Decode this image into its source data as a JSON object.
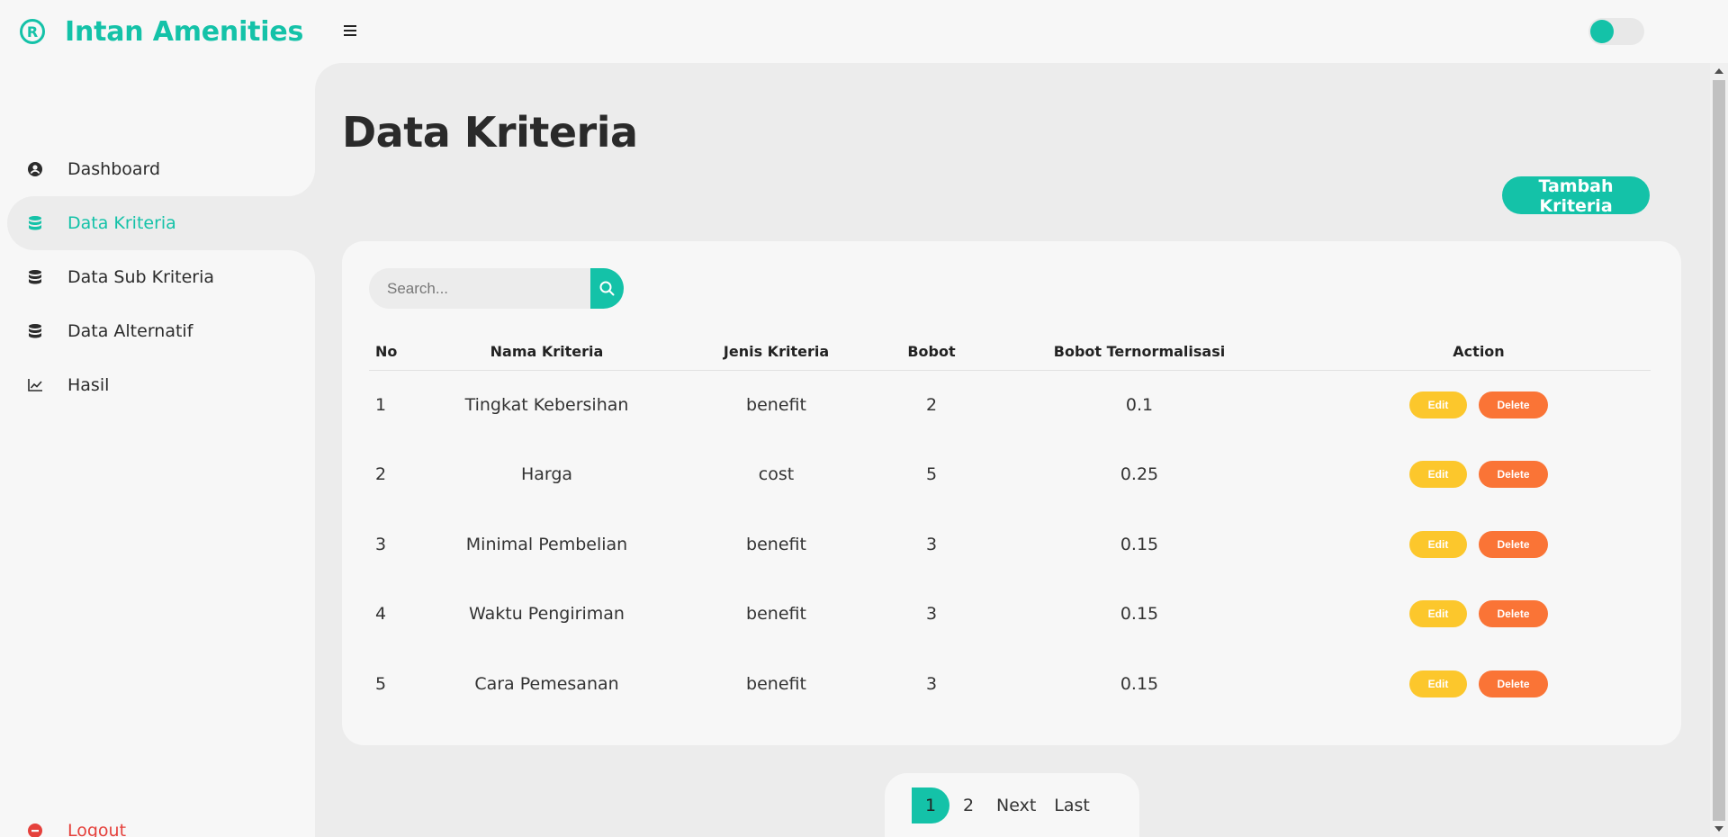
{
  "app": {
    "brand_name": "Intan Amenities",
    "brand_icon": "registered-icon",
    "accent_color": "#14c2a8"
  },
  "sidebar": {
    "items": [
      {
        "label": "Dashboard",
        "icon": "user-circle-icon",
        "active": false
      },
      {
        "label": "Data Kriteria",
        "icon": "database-icon",
        "active": true
      },
      {
        "label": "Data Sub Kriteria",
        "icon": "database-icon",
        "active": false
      },
      {
        "label": "Data Alternatif",
        "icon": "database-icon",
        "active": false
      },
      {
        "label": "Hasil",
        "icon": "line-chart-icon",
        "active": false
      }
    ],
    "logout_label": "Logout"
  },
  "main": {
    "title": "Data Kriteria",
    "add_button_label": "Tambah Kriteria",
    "search": {
      "placeholder": "Search..."
    }
  },
  "table": {
    "headers": [
      "No",
      "Nama Kriteria",
      "Jenis Kriteria",
      "Bobot",
      "Bobot Ternormalisasi",
      "Action"
    ],
    "edit_label": "Edit",
    "delete_label": "Delete",
    "rows": [
      {
        "no": "1",
        "nama": "Tingkat Kebersihan",
        "jenis": "benefit",
        "bobot": "2",
        "normal": "0.1"
      },
      {
        "no": "2",
        "nama": "Harga",
        "jenis": "cost",
        "bobot": "5",
        "normal": "0.25"
      },
      {
        "no": "3",
        "nama": "Minimal Pembelian",
        "jenis": "benefit",
        "bobot": "3",
        "normal": "0.15"
      },
      {
        "no": "4",
        "nama": "Waktu Pengiriman",
        "jenis": "benefit",
        "bobot": "3",
        "normal": "0.15"
      },
      {
        "no": "5",
        "nama": "Cara Pemesanan",
        "jenis": "benefit",
        "bobot": "3",
        "normal": "0.15"
      }
    ]
  },
  "pagination": {
    "current": "1",
    "next_page": "2",
    "next_label": "Next",
    "last_label": "Last"
  }
}
